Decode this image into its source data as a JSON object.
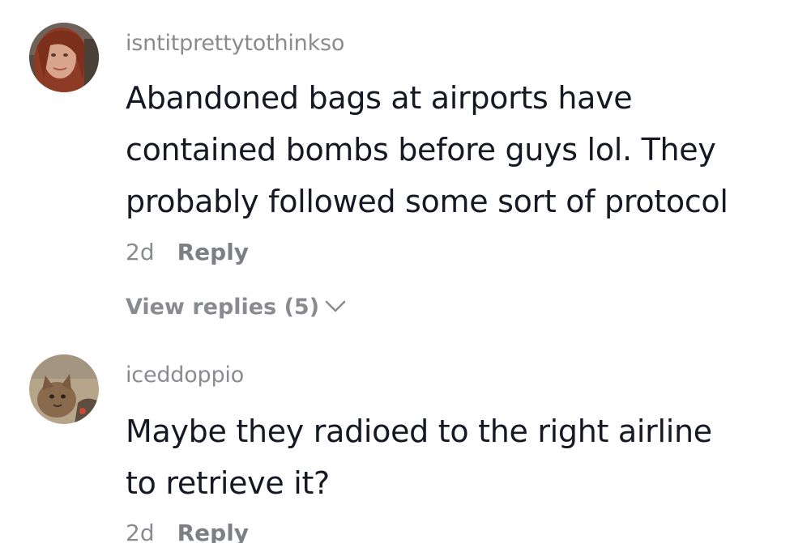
{
  "comments": [
    {
      "username": "isntitprettytothinkso",
      "text_lines": [
        "Abandoned bags at airports have",
        "contained bombs before guys lol. They",
        "probably followed some sort of protocol"
      ],
      "time": "2d",
      "reply_label": "Reply",
      "view_replies_label": "View replies (5)",
      "avatar_icon": "user-avatar-red-hair",
      "avatar_colors": {
        "hair": "#8e3b25",
        "skin": "#d9a48c",
        "bg": "#5a4a40"
      }
    },
    {
      "username": "iceddoppio",
      "text_lines": [
        "Maybe they radioed to the right airline",
        "to retrieve it?"
      ],
      "time": "2d",
      "reply_label": "Reply",
      "avatar_icon": "user-avatar-cat",
      "avatar_colors": {
        "bg": "#b7a58a",
        "cat": "#8a6a4c",
        "dark": "#3e3228"
      }
    }
  ],
  "icons": {
    "expand": "chevron-down-icon"
  },
  "colors": {
    "text": "#161823",
    "muted": "#8a8b91"
  }
}
